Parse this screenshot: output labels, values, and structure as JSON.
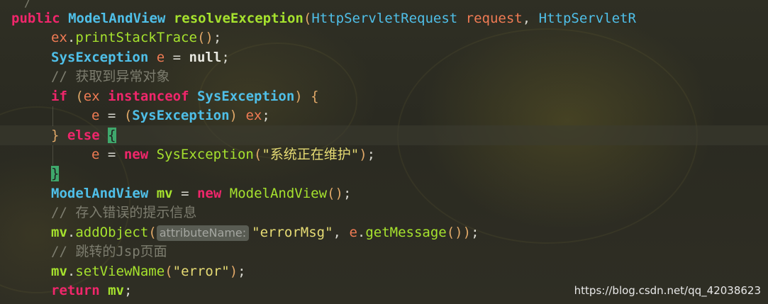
{
  "code": {
    "l1": {
      "kw_public": "public",
      "type": "ModelAndView",
      "method": "resolveException",
      "p_open": "(",
      "param_type": "HttpServletRequest",
      "param_name": "request",
      "comma": ",",
      "param_type2": "HttpServletR"
    },
    "l2": {
      "obj": "ex",
      "dot": ".",
      "call": "printStackTrace",
      "parens": "()",
      "semi": ";"
    },
    "l3": {
      "type": "SysException",
      "var": "e",
      "assign": "=",
      "val": "null",
      "semi": ";"
    },
    "l4": {
      "comment": "// 获取到异常对象"
    },
    "l5": {
      "kw_if": "if",
      "p_open": "(",
      "obj": "ex",
      "kw_instanceof": "instanceof",
      "type": "SysException",
      "p_close": ")",
      "brace": "{"
    },
    "l6": {
      "var": "e",
      "assign": "=",
      "p_open": "(",
      "cast": "SysException",
      "p_close": ")",
      "obj": "ex",
      "semi": ";"
    },
    "l7": {
      "brace_close": "}",
      "kw_else": "else",
      "brace_open": "{"
    },
    "l8": {
      "var": "e",
      "assign": "=",
      "kw_new": "new",
      "ctor": "SysException",
      "p_open": "(",
      "str": "\"系统正在维护\"",
      "p_close": ")",
      "semi": ";"
    },
    "l9": {
      "brace": "}"
    },
    "l10": {
      "type": "ModelAndView",
      "var": "mv",
      "assign": "=",
      "kw_new": "new",
      "ctor": "ModelAndView",
      "parens": "()",
      "semi": ";"
    },
    "l11": {
      "comment": "// 存入错误的提示信息"
    },
    "l12": {
      "obj": "mv",
      "dot": ".",
      "call": "addObject",
      "p_open": "(",
      "hint": "attributeName:",
      "str": "\"errorMsg\"",
      "comma": ",",
      "obj2": "e",
      "dot2": ".",
      "call2": "getMessage",
      "p_close": "())",
      "semi": ";"
    },
    "l13": {
      "comment": "// 跳转的Jsp页面"
    },
    "l14": {
      "obj": "mv",
      "dot": ".",
      "call": "setViewName",
      "p_open": "(",
      "str": "\"error\"",
      "p_close": ")",
      "semi": ";"
    },
    "l15": {
      "kw_return": "return",
      "obj": "mv",
      "semi": ";"
    }
  },
  "top_fragment": "/",
  "watermark": "https://blog.csdn.net/qq_42038623",
  "colors": {
    "keyword": "#f0266b",
    "type": "#4fbfe8",
    "method": "#a6e22e",
    "string": "#e6db74",
    "comment": "#7d7d6f",
    "identifier": "#ff9a3c",
    "brace_highlight": "#3fa86c"
  }
}
